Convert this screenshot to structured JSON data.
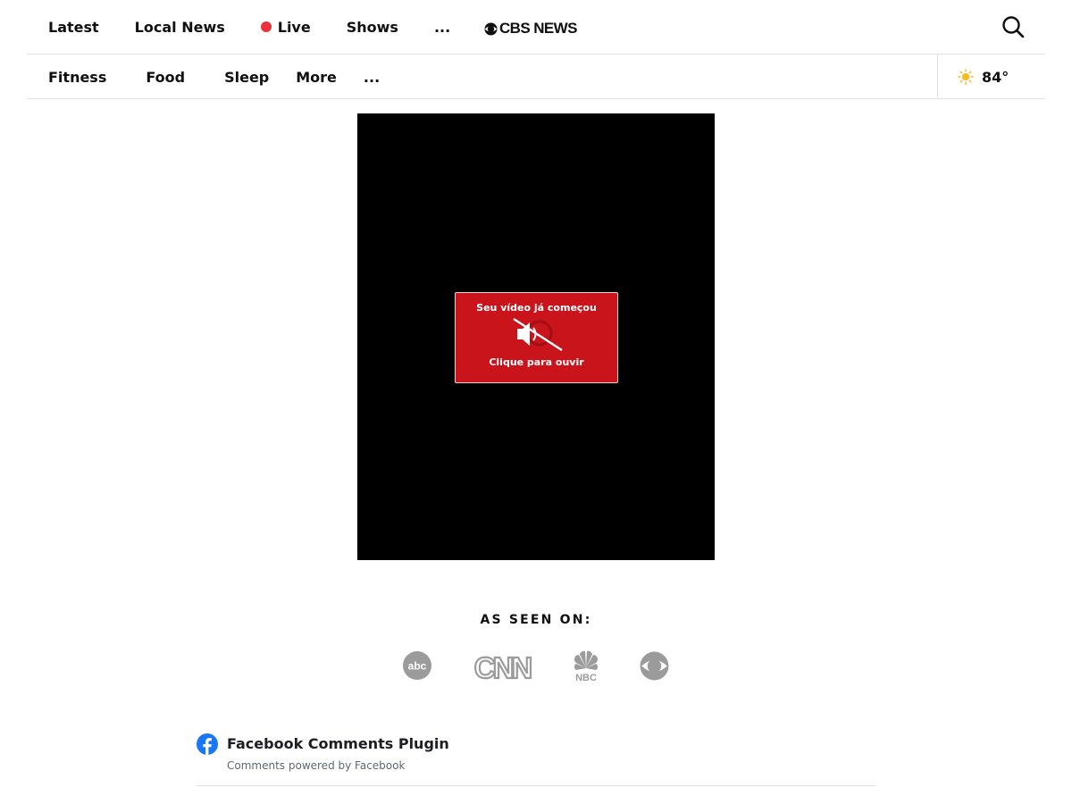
{
  "header": {
    "nav": [
      {
        "label": "Latest"
      },
      {
        "label": "Local News"
      },
      {
        "label": "Live",
        "indicator": "live-dot"
      },
      {
        "label": "Shows"
      },
      {
        "label": "..."
      }
    ],
    "logo_text": "CBS NEWS",
    "search_icon": "search-icon"
  },
  "subnav": {
    "items": [
      {
        "label": "Fitness"
      },
      {
        "label": "Food"
      },
      {
        "label": "Sleep"
      },
      {
        "label": "More"
      },
      {
        "label": "..."
      }
    ],
    "weather": {
      "icon": "sun-icon",
      "temp": "84°"
    }
  },
  "video": {
    "unmute_title": "Seu vídeo já começou",
    "unmute_subtitle": "Clique para ouvir",
    "icon": "muted-speaker-icon"
  },
  "as_seen_on": {
    "heading": "AS SEEN ON:",
    "logos": [
      "abc-logo",
      "cnn-logo",
      "nbc-logo",
      "cbs-logo"
    ]
  },
  "facebook": {
    "title": "Facebook Comments Plugin",
    "subtitle": "Comments powered by Facebook"
  },
  "colors": {
    "live": "#e8323c",
    "unmute_bg": "#c8141a",
    "logo_gray": "#9b9b9b",
    "facebook_blue": "#1877f2",
    "sun": "#f5b920"
  }
}
